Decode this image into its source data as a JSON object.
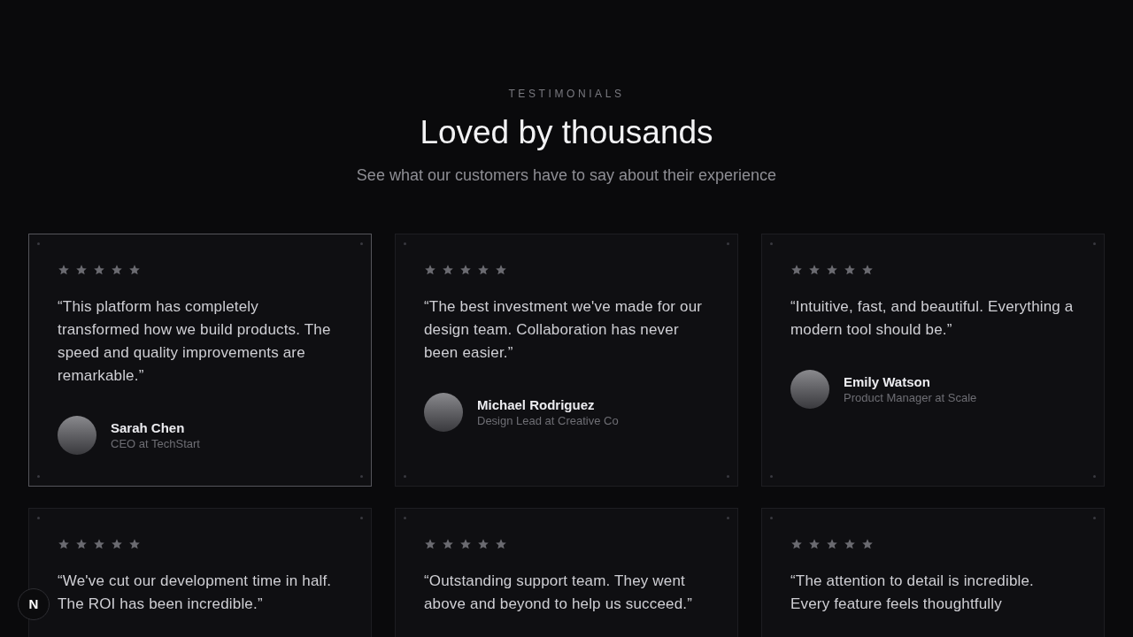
{
  "section": {
    "eyebrow": "TESTIMONIALS",
    "title": "Loved by thousands",
    "subtitle": "See what our customers have to say about their experience"
  },
  "testimonials": [
    {
      "stars": 5,
      "selected": true,
      "quote": "“This platform has completely transformed how we build products. The speed and quality improvements are remarkable.”",
      "name": "Sarah Chen",
      "role": "CEO at TechStart"
    },
    {
      "stars": 5,
      "selected": false,
      "quote": "“The best investment we've made for our design team. Collaboration has never been easier.”",
      "name": "Michael Rodriguez",
      "role": "Design Lead at Creative Co"
    },
    {
      "stars": 5,
      "selected": false,
      "quote": "“Intuitive, fast, and beautiful. Everything a modern tool should be.”",
      "name": "Emily Watson",
      "role": "Product Manager at Scale"
    },
    {
      "stars": 5,
      "selected": false,
      "quote": "“We've cut our development time in half. The ROI has been incredible.”"
    },
    {
      "stars": 5,
      "selected": false,
      "quote": "“Outstanding support team. They went above and beyond to help us succeed.”"
    },
    {
      "stars": 5,
      "selected": false,
      "quote": "“The attention to detail is incredible. Every feature feels thoughtfully"
    }
  ],
  "dev_badge": {
    "label": "N"
  }
}
